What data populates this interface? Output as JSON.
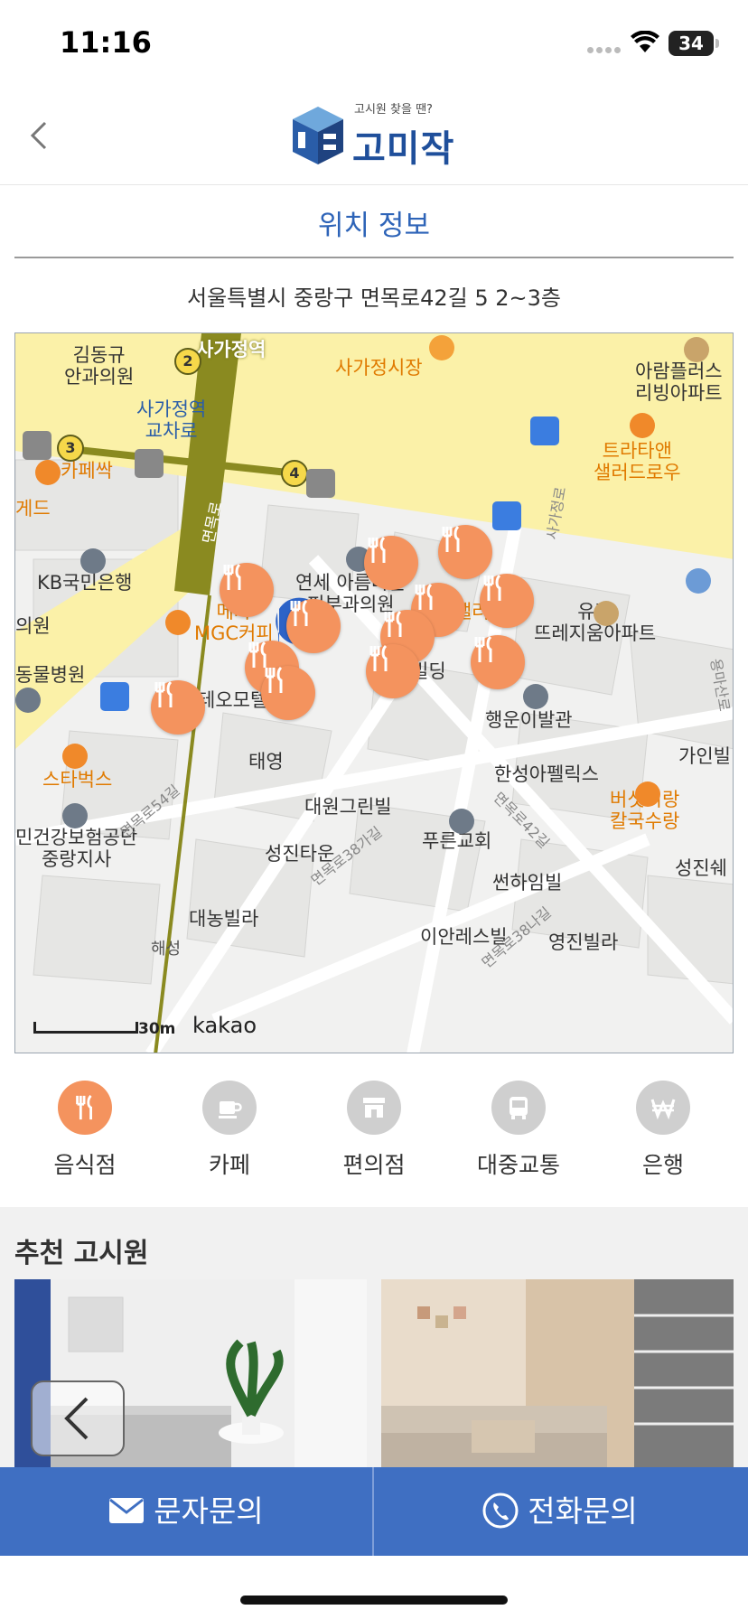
{
  "status_bar": {
    "time": "11:16",
    "battery": "34"
  },
  "header": {
    "logo_tagline": "고시원 찾을 땐?",
    "logo_text": "고미작"
  },
  "section": {
    "title": "위치 정보",
    "address": "서울특별시 중랑구 면목로42길 5 2~3층"
  },
  "map": {
    "labels": [
      "김동규\n안과의원",
      "사가정역",
      "사가정시장",
      "아람플러스\n리빙아파트",
      "사가정역\n교차로",
      "트라타앤\n샐러드로우",
      "카페싹",
      "게드",
      "KB국민은행",
      "연세 아름다운\n피부과의원",
      "샐러드마",
      "유진\n뜨레지움아파트",
      "의원",
      "메가\nMGC커피",
      "빌딩",
      "동물병원",
      "테오모텔",
      "행운이발관",
      "가인빌",
      "스타벅스",
      "태영",
      "한성아펠릭스",
      "대원그린빌",
      "버섯이랑\n칼국수랑",
      "민건강보험공단\n중랑지사",
      "성진타운",
      "푸른교회",
      "성진쉐",
      "썬하임빌",
      "대농빌라",
      "이안레스빌",
      "영진빌라",
      "면목로",
      "사가정로",
      "면목로54길",
      "면목로38가길",
      "면목로42길",
      "용마산로",
      "면목로38나길",
      "해성"
    ],
    "station_numbers": [
      "2",
      "3",
      "4"
    ],
    "scale": "30m",
    "provider": "kakao"
  },
  "categories": [
    {
      "label": "음식점",
      "icon": "fork-knife-icon",
      "active": true
    },
    {
      "label": "카페",
      "icon": "coffee-cup-icon",
      "active": false
    },
    {
      "label": "편의점",
      "icon": "store-icon",
      "active": false
    },
    {
      "label": "대중교통",
      "icon": "bus-icon",
      "active": false
    },
    {
      "label": "은행",
      "icon": "won-icon",
      "active": false
    }
  ],
  "recommend": {
    "title": "추천 고시원"
  },
  "bottom_bar": {
    "sms_label": "문자문의",
    "call_label": "전화문의"
  },
  "colors": {
    "brand_blue": "#2e64b8",
    "bottom_bar": "#3f6fc2",
    "active_orange": "#f4935e"
  }
}
